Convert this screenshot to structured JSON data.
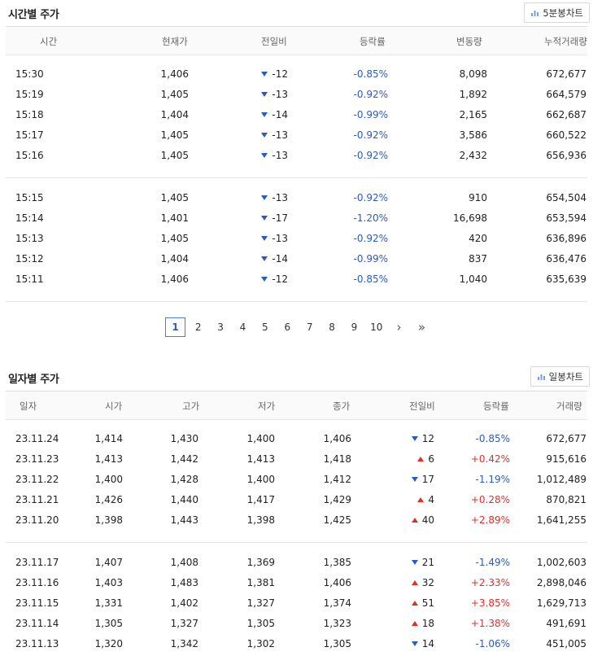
{
  "intraday": {
    "title": "시간별 주가",
    "chart_button": "5분봉차트",
    "headers": [
      "시간",
      "현재가",
      "전일비",
      "등락률",
      "변동량",
      "누적거래량"
    ],
    "rows": [
      {
        "time": "15:30",
        "price": "1,406",
        "change": "-12",
        "dir": "down",
        "rate": "-0.85%",
        "vol": "8,098",
        "cum": "672,677"
      },
      {
        "time": "15:19",
        "price": "1,405",
        "change": "-13",
        "dir": "down",
        "rate": "-0.92%",
        "vol": "1,892",
        "cum": "664,579"
      },
      {
        "time": "15:18",
        "price": "1,404",
        "change": "-14",
        "dir": "down",
        "rate": "-0.99%",
        "vol": "2,165",
        "cum": "662,687"
      },
      {
        "time": "15:17",
        "price": "1,405",
        "change": "-13",
        "dir": "down",
        "rate": "-0.92%",
        "vol": "3,586",
        "cum": "660,522"
      },
      {
        "time": "15:16",
        "price": "1,405",
        "change": "-13",
        "dir": "down",
        "rate": "-0.92%",
        "vol": "2,432",
        "cum": "656,936"
      },
      {
        "time": "15:15",
        "price": "1,405",
        "change": "-13",
        "dir": "down",
        "rate": "-0.92%",
        "vol": "910",
        "cum": "654,504"
      },
      {
        "time": "15:14",
        "price": "1,401",
        "change": "-17",
        "dir": "down",
        "rate": "-1.20%",
        "vol": "16,698",
        "cum": "653,594"
      },
      {
        "time": "15:13",
        "price": "1,405",
        "change": "-13",
        "dir": "down",
        "rate": "-0.92%",
        "vol": "420",
        "cum": "636,896"
      },
      {
        "time": "15:12",
        "price": "1,404",
        "change": "-14",
        "dir": "down",
        "rate": "-0.99%",
        "vol": "837",
        "cum": "636,476"
      },
      {
        "time": "15:11",
        "price": "1,406",
        "change": "-12",
        "dir": "down",
        "rate": "-0.85%",
        "vol": "1,040",
        "cum": "635,639"
      }
    ]
  },
  "pagination": {
    "pages": [
      "1",
      "2",
      "3",
      "4",
      "5",
      "6",
      "7",
      "8",
      "9",
      "10"
    ],
    "current": "1",
    "next": "›",
    "last": "»"
  },
  "daily": {
    "title": "일자별 주가",
    "chart_button": "일봉차트",
    "headers": [
      "일자",
      "시가",
      "고가",
      "저가",
      "종가",
      "전일비",
      "등락률",
      "거래량"
    ],
    "rows": [
      {
        "date": "23.11.24",
        "open": "1,414",
        "high": "1,430",
        "low": "1,400",
        "close": "1,406",
        "change": "12",
        "dir": "down",
        "rate": "-0.85%",
        "vol": "672,677"
      },
      {
        "date": "23.11.23",
        "open": "1,413",
        "high": "1,442",
        "low": "1,413",
        "close": "1,418",
        "change": "6",
        "dir": "up",
        "rate": "+0.42%",
        "vol": "915,616"
      },
      {
        "date": "23.11.22",
        "open": "1,400",
        "high": "1,428",
        "low": "1,400",
        "close": "1,412",
        "change": "17",
        "dir": "down",
        "rate": "-1.19%",
        "vol": "1,012,489"
      },
      {
        "date": "23.11.21",
        "open": "1,426",
        "high": "1,440",
        "low": "1,417",
        "close": "1,429",
        "change": "4",
        "dir": "up",
        "rate": "+0.28%",
        "vol": "870,821"
      },
      {
        "date": "23.11.20",
        "open": "1,398",
        "high": "1,443",
        "low": "1,398",
        "close": "1,425",
        "change": "40",
        "dir": "up",
        "rate": "+2.89%",
        "vol": "1,641,255"
      },
      {
        "date": "23.11.17",
        "open": "1,407",
        "high": "1,408",
        "low": "1,369",
        "close": "1,385",
        "change": "21",
        "dir": "down",
        "rate": "-1.49%",
        "vol": "1,002,603"
      },
      {
        "date": "23.11.16",
        "open": "1,403",
        "high": "1,483",
        "low": "1,381",
        "close": "1,406",
        "change": "32",
        "dir": "up",
        "rate": "+2.33%",
        "vol": "2,898,046"
      },
      {
        "date": "23.11.15",
        "open": "1,331",
        "high": "1,402",
        "low": "1,327",
        "close": "1,374",
        "change": "51",
        "dir": "up",
        "rate": "+3.85%",
        "vol": "1,629,713"
      },
      {
        "date": "23.11.14",
        "open": "1,305",
        "high": "1,327",
        "low": "1,305",
        "close": "1,323",
        "change": "18",
        "dir": "up",
        "rate": "+1.38%",
        "vol": "491,691"
      },
      {
        "date": "23.11.13",
        "open": "1,320",
        "high": "1,342",
        "low": "1,302",
        "close": "1,305",
        "change": "14",
        "dir": "down",
        "rate": "-1.06%",
        "vol": "451,005"
      }
    ]
  },
  "colors": {
    "down": "#2c5bbd",
    "up": "#e0302b",
    "active_page": "#4a7ed6"
  }
}
